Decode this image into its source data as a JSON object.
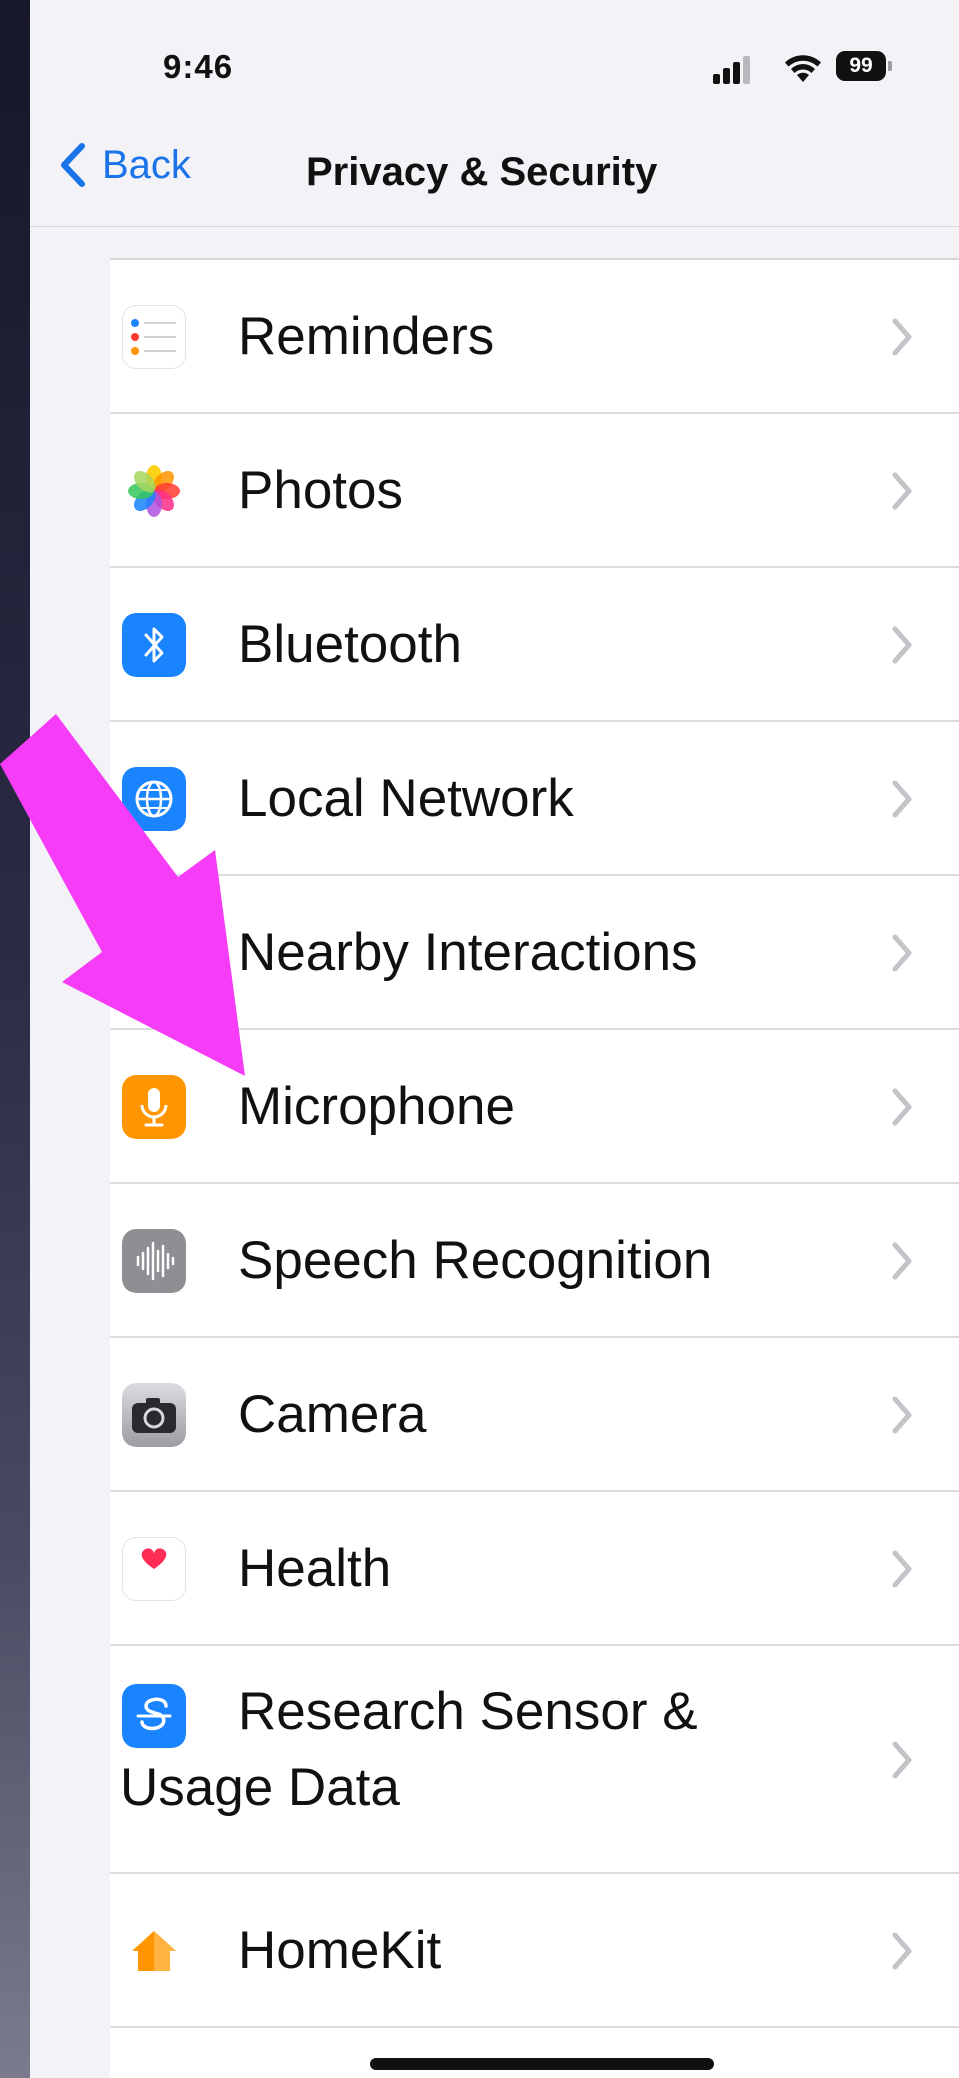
{
  "status_bar": {
    "time": "9:46",
    "battery": "99"
  },
  "nav": {
    "back_label": "Back",
    "title": "Privacy & Security"
  },
  "items": [
    {
      "label": "Reminders"
    },
    {
      "label": "Photos"
    },
    {
      "label": "Bluetooth"
    },
    {
      "label": "Local Network"
    },
    {
      "label": "Nearby Interactions"
    },
    {
      "label": "Microphone"
    },
    {
      "label": "Speech Recognition"
    },
    {
      "label": "Camera"
    },
    {
      "label": "Health"
    },
    {
      "label": "Research Sensor & Usage Data"
    },
    {
      "label": "HomeKit"
    }
  ],
  "colors": {
    "annotation_arrow": "#f63cf6",
    "link_blue": "#1a73e8",
    "bluetooth": "#1a84ff",
    "local_network": "#1a84ff",
    "microphone": "#ff9500",
    "speech_recognition": "#8e8e93",
    "camera": "#6b6b70",
    "research": "#1a84ff",
    "homekit": "#ff9500"
  }
}
